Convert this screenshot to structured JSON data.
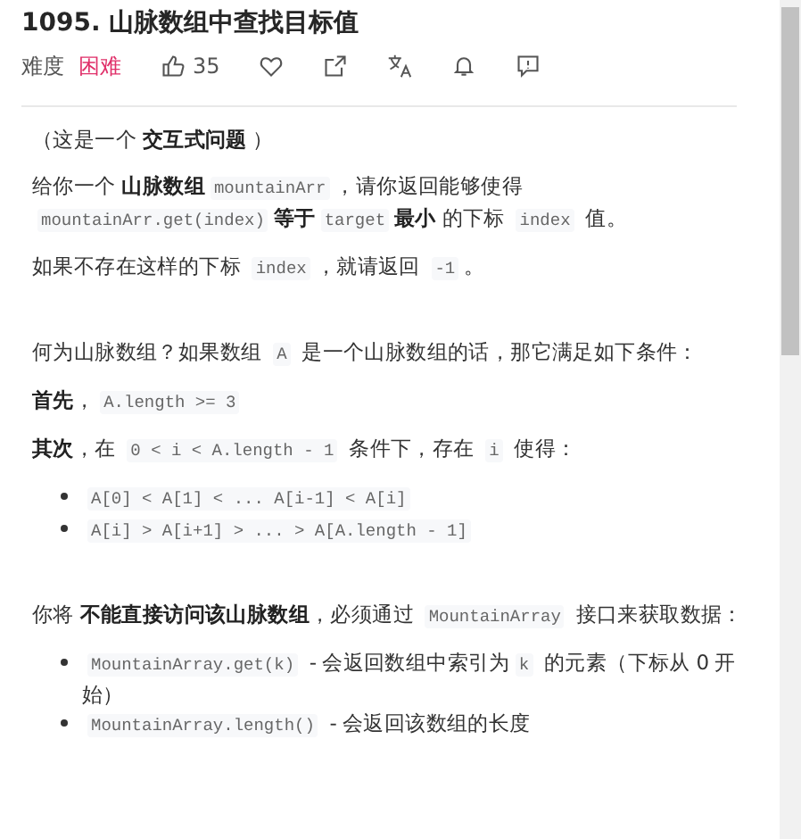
{
  "title": "1095. 山脉数组中查找目标值",
  "meta": {
    "difficulty_label": "难度",
    "difficulty": "困难"
  },
  "actions": [
    {
      "kind": "thumbs-up",
      "count": "35"
    },
    {
      "kind": "heart"
    },
    {
      "kind": "share"
    },
    {
      "kind": "translate"
    },
    {
      "kind": "bell"
    },
    {
      "kind": "comment"
    }
  ],
  "content": [
    {
      "kind": "para",
      "segments": [
        {
          "kind": "text",
          "text": "（这是一个 "
        },
        {
          "kind": "bold",
          "text": "交互式问题"
        },
        {
          "kind": "text",
          "text": " ）"
        }
      ]
    },
    {
      "kind": "para",
      "segments": [
        {
          "kind": "text",
          "text": "给你一个 "
        },
        {
          "kind": "bold",
          "text": "山脉数组"
        },
        {
          "kind": "code",
          "text": "mountainArr"
        },
        {
          "kind": "text",
          "text": "，请你返回能够使得 "
        },
        {
          "kind": "code",
          "text": "mountainArr.get(index)"
        },
        {
          "kind": "bold",
          "text": "等于"
        },
        {
          "kind": "code",
          "text": "target"
        },
        {
          "kind": "bold",
          "text": "最小"
        },
        {
          "kind": "text",
          "text": " 的下标 "
        },
        {
          "kind": "code",
          "text": "index"
        },
        {
          "kind": "text",
          "text": " 值。"
        }
      ]
    },
    {
      "kind": "para",
      "segments": [
        {
          "kind": "text",
          "text": "如果不存在这样的下标 "
        },
        {
          "kind": "code",
          "text": "index"
        },
        {
          "kind": "text",
          "text": "，就请返回 "
        },
        {
          "kind": "code",
          "text": "-1"
        },
        {
          "kind": "text",
          "text": "。"
        }
      ]
    },
    {
      "kind": "para",
      "spaced": true,
      "segments": [
        {
          "kind": "text",
          "text": "何为山脉数组？如果数组 "
        },
        {
          "kind": "code",
          "text": "A"
        },
        {
          "kind": "text",
          "text": " 是一个山脉数组的话，那它满足如下条件："
        }
      ]
    },
    {
      "kind": "para",
      "segments": [
        {
          "kind": "bold",
          "text": "首先"
        },
        {
          "kind": "text",
          "text": "，"
        },
        {
          "kind": "code",
          "text": "A.length >= 3"
        }
      ]
    },
    {
      "kind": "para",
      "segments": [
        {
          "kind": "bold",
          "text": "其次"
        },
        {
          "kind": "text",
          "text": "，在 "
        },
        {
          "kind": "code",
          "text": "0 < i  < A.length - 1"
        },
        {
          "kind": "text",
          "text": " 条件下，存在 "
        },
        {
          "kind": "code",
          "text": "i"
        },
        {
          "kind": "text",
          "text": " 使得："
        }
      ]
    },
    {
      "kind": "list",
      "items": [
        [
          {
            "kind": "code",
            "text": "A[0] < A[1] < ... A[i-1] < A[i]"
          }
        ],
        [
          {
            "kind": "code",
            "text": "A[i] > A[i+1] > ... > A[A.length - 1]"
          }
        ]
      ]
    },
    {
      "kind": "para",
      "spaced": true,
      "segments": [
        {
          "kind": "text",
          "text": "你将 "
        },
        {
          "kind": "bold",
          "text": "不能直接访问该山脉数组"
        },
        {
          "kind": "text",
          "text": "，必须通过 "
        },
        {
          "kind": "code",
          "text": "MountainArray"
        },
        {
          "kind": "text",
          "text": " 接口来获取数据："
        }
      ]
    },
    {
      "kind": "list",
      "items": [
        [
          {
            "kind": "code",
            "text": "MountainArray.get(k)"
          },
          {
            "kind": "text",
            "text": " - 会返回数组中索引为"
          },
          {
            "kind": "code",
            "text": "k"
          },
          {
            "kind": "text",
            "text": " 的元素（下标从 0 开始）"
          }
        ],
        [
          {
            "kind": "code",
            "text": "MountainArray.length()"
          },
          {
            "kind": "text",
            "text": " - 会返回该数组的长度"
          }
        ]
      ]
    }
  ]
}
